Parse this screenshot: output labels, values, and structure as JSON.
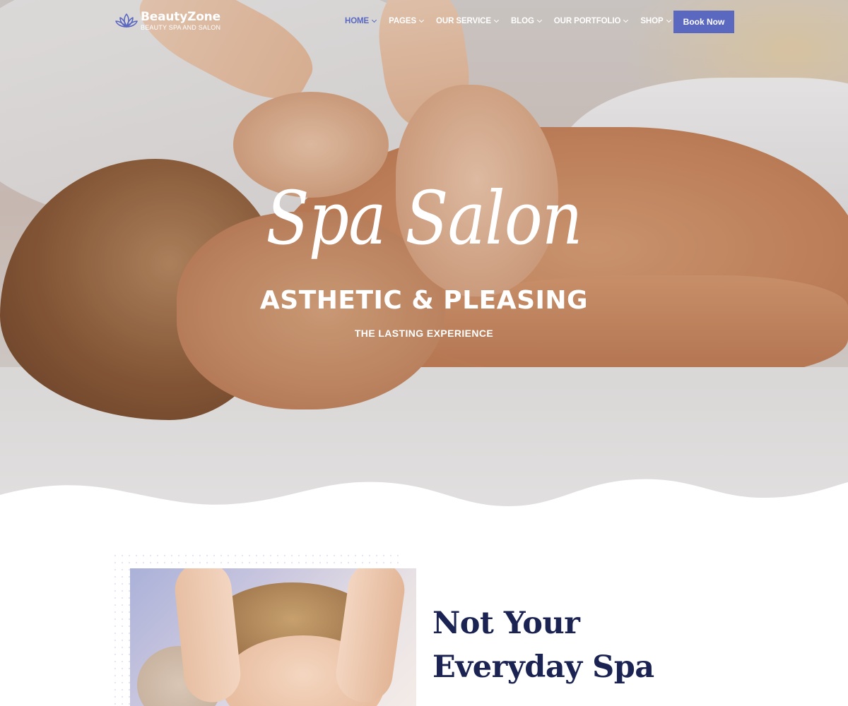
{
  "brand": {
    "name": "BeautyZone",
    "tagline": "BEAUTY SPA AND SALON",
    "logo_icon": "lotus-icon",
    "accent_color": "#5b68c0"
  },
  "nav": {
    "items": [
      {
        "label": "HOME",
        "active": true
      },
      {
        "label": "PAGES",
        "active": false
      },
      {
        "label": "OUR SERVICE",
        "active": false
      },
      {
        "label": "BLOG",
        "active": false
      },
      {
        "label": "OUR PORTFOLIO",
        "active": false
      },
      {
        "label": "SHOP",
        "active": false
      }
    ],
    "dropdown_icon": "chevron-down-icon",
    "cta_label": "Book Now"
  },
  "hero": {
    "title": "Spa Salon",
    "subtitle": "ASTHETIC & PLEASING",
    "tagline": "THE LASTING EXPERIENCE"
  },
  "about": {
    "title_line1": "Not Your",
    "title_line2": "Everyday Spa",
    "title_color": "#1b2352"
  }
}
